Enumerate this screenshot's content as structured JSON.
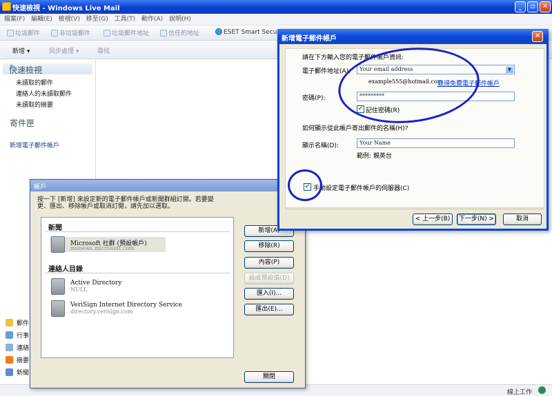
{
  "window": {
    "title": "快速檢視 - Windows Live Mail",
    "status": "線上工作"
  },
  "menu": [
    "檔案(F)",
    "編輯(E)",
    "檢視(V)",
    "移至(G)",
    "工具(T)",
    "動作(A)",
    "說明(H)"
  ],
  "toolbar": {
    "junk": "垃圾郵件",
    "not_junk": "非垃圾郵件",
    "junk_address": "垃圾郵件地址",
    "trusted_address": "信任的地址",
    "eset": "ESET Smart Security"
  },
  "commands": {
    "new": "新增",
    "sync": "同步處理",
    "find": "尋找"
  },
  "sidebar": {
    "quick_views": "快速檢視",
    "items": [
      "未讀取的郵件",
      "連絡人的未讀取郵件",
      "未讀取的摘要"
    ],
    "outbox": "寄件匣",
    "add_account": "新增電子郵件帳戶",
    "nav": [
      "郵件",
      "行事曆",
      "連絡人",
      "摘要",
      "新聞群組"
    ],
    "nav_visible": [
      "郵件",
      "行事",
      "連絡",
      "摘要",
      "新聞"
    ]
  },
  "accounts_dialog": {
    "title": "帳戶",
    "description": "按一下 [新增] 來設定新的電子郵件帳戶或新聞群組訂閱。若要變更、匯出、移除帳戶或取消訂閱，請先加以選取。",
    "news_group": "新聞",
    "contacts_group": "連絡人目錄",
    "accounts": [
      {
        "name": "Microsoft 社群 (預設帳戶)",
        "server": "msnews.microsoft.com"
      },
      {
        "name": "Active Directory",
        "server": "NULL"
      },
      {
        "name": "VeriSign Internet Directory Service",
        "server": "directory.verisign.com"
      }
    ],
    "buttons": {
      "add": "新增(A)",
      "remove": "移除(R)",
      "properties": "內容(P)",
      "set_default": "設成預設值(D)",
      "import": "匯入(I)...",
      "export": "匯出(E)...",
      "close": "關閉"
    }
  },
  "new_account_dialog": {
    "title": "新增電子郵件帳戶",
    "intro": "請在下方輸入您的電子郵件帳戶資訊:",
    "email_label": "電子郵件地址(A):",
    "email_value": "Your email address",
    "email_example": "example555@hotmail.com",
    "get_free_link": "取得免費電子郵件帳戶",
    "password_label": "密碼(P):",
    "password_value": "*********",
    "remember_password": "記住密碼(R)",
    "display_name_question": "如何顯示從此帳戶寄出郵件的名稱(H)?",
    "display_name_label": "顯示名稱(D):",
    "display_name_value": "Your Name",
    "display_name_example": "範例: 親英台",
    "manual_config": "手動設定電子郵件帳戶的伺服器(C)",
    "buttons": {
      "back": "< 上一步(B)",
      "next": "下一步(N) >",
      "cancel": "取消"
    }
  },
  "colors": {
    "title_blue": "#0a48d8",
    "annotation_ring": "#1820c8",
    "dialog_bg": "#ece9d8"
  }
}
